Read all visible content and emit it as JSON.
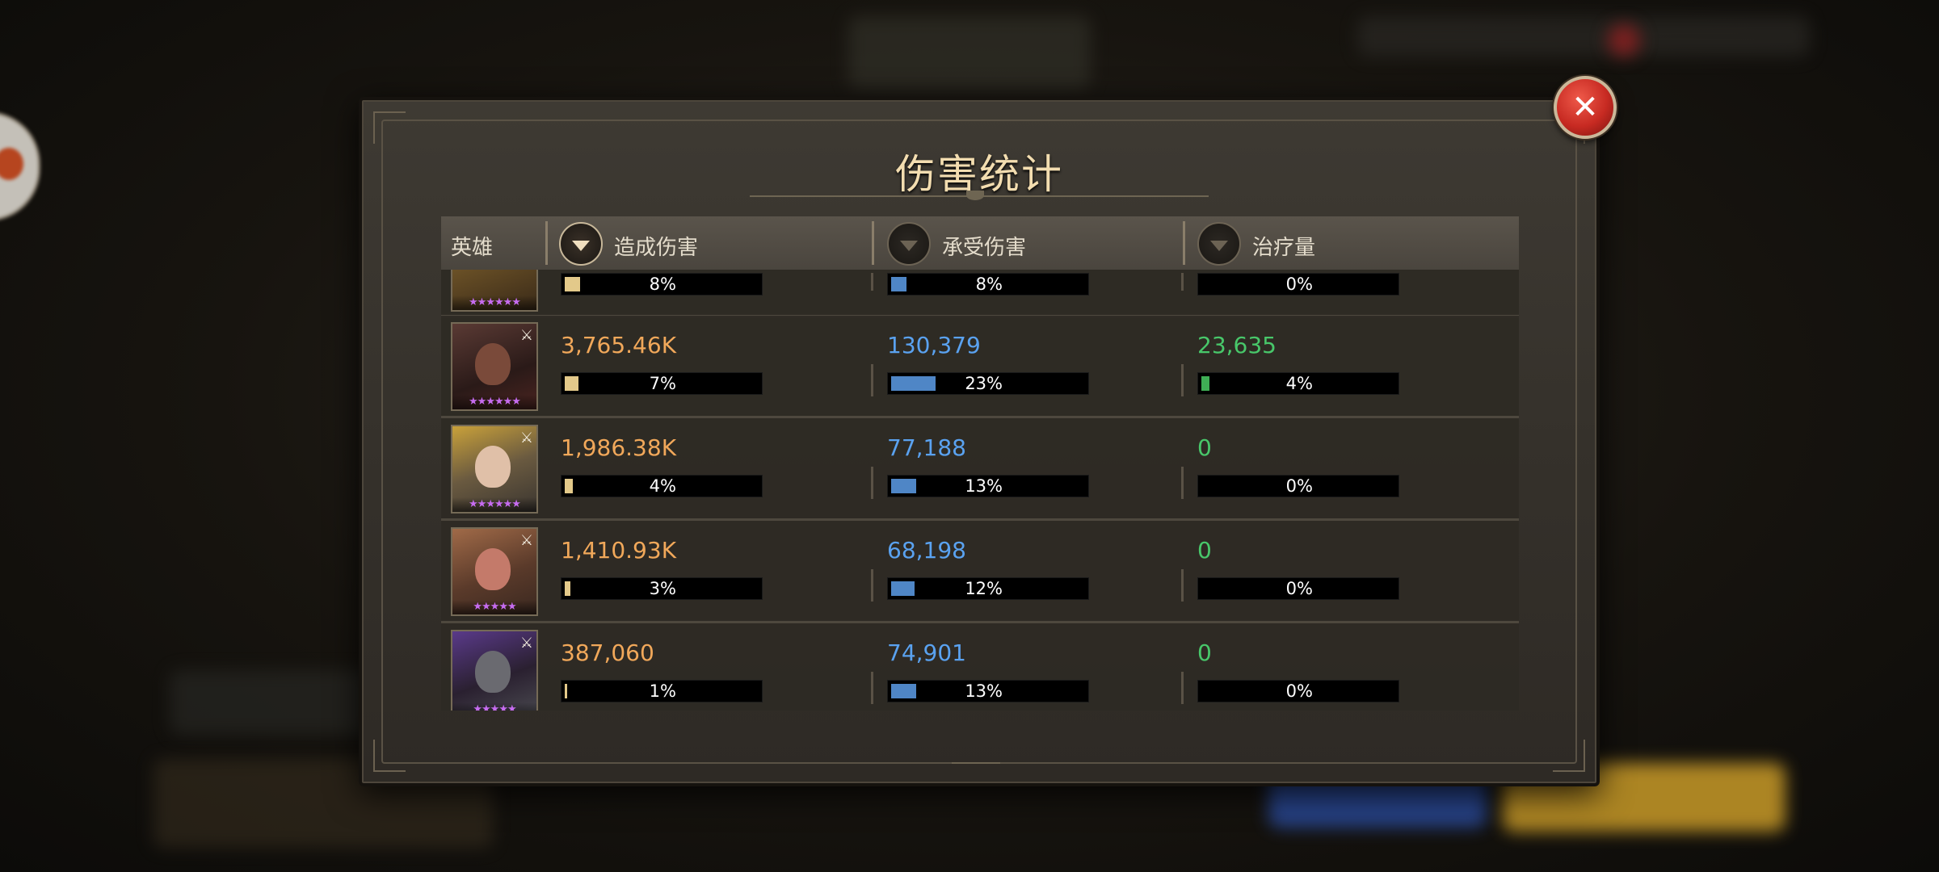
{
  "dialog": {
    "title": "伤害统计",
    "close_icon": "close-icon"
  },
  "header": {
    "hero": "英雄",
    "damage_dealt": "造成伤害",
    "damage_taken": "承受伤害",
    "healing": "治疗量",
    "active_sort": "damage_dealt"
  },
  "colors": {
    "damage_dealt": "#f1a85a",
    "damage_taken": "#5aa2f0",
    "healing": "#48c76a",
    "dealt_bar": "#e3c98a",
    "taken_bar": "#4f86c6",
    "heal_bar": "#3fae55",
    "star": "#c66cf0"
  },
  "rows": [
    {
      "partial": true,
      "stars": "★★★★★★",
      "dealt_pct": "8%",
      "dealt_fill": 0.08,
      "taken_pct": "8%",
      "taken_fill": 0.08,
      "heal_pct": "0%",
      "heal_fill": 0
    },
    {
      "stars": "★★★★★★",
      "dealt": "3,765.46K",
      "dealt_pct": "7%",
      "dealt_fill": 0.07,
      "taken": "130,379",
      "taken_pct": "23%",
      "taken_fill": 0.23,
      "heal": "23,635",
      "heal_pct": "4%",
      "heal_fill": 0.04
    },
    {
      "stars": "★★★★★★",
      "dealt": "1,986.38K",
      "dealt_pct": "4%",
      "dealt_fill": 0.04,
      "taken": "77,188",
      "taken_pct": "13%",
      "taken_fill": 0.13,
      "heal": "0",
      "heal_pct": "0%",
      "heal_fill": 0
    },
    {
      "stars": "★★★★★",
      "dealt": "1,410.93K",
      "dealt_pct": "3%",
      "dealt_fill": 0.03,
      "taken": "68,198",
      "taken_pct": "12%",
      "taken_fill": 0.12,
      "heal": "0",
      "heal_pct": "0%",
      "heal_fill": 0
    },
    {
      "stars": "★★★★★",
      "dealt": "387,060",
      "dealt_pct": "1%",
      "dealt_fill": 0.01,
      "taken": "74,901",
      "taken_pct": "13%",
      "taken_fill": 0.13,
      "heal": "0",
      "heal_pct": "0%",
      "heal_fill": 0
    }
  ]
}
